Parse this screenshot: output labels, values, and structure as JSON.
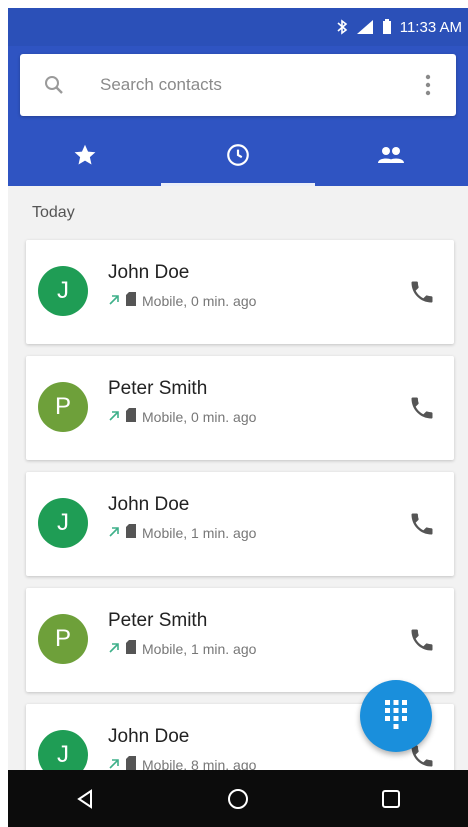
{
  "status_bar": {
    "time": "11:33 AM",
    "icons": [
      "bluetooth-icon",
      "signal-icon",
      "battery-icon"
    ]
  },
  "search": {
    "placeholder": "Search contacts",
    "icon": "search-icon",
    "menu_icon": "more-vert-icon"
  },
  "tabs": [
    {
      "icon": "star-icon",
      "active": false
    },
    {
      "icon": "clock-icon",
      "active": true
    },
    {
      "icon": "people-icon",
      "active": false
    }
  ],
  "section_title": "Today",
  "calls": [
    {
      "initial": "J",
      "name": "John Doe",
      "detail": "Mobile, 0 min. ago",
      "avatar_color": "#1f9d55"
    },
    {
      "initial": "P",
      "name": "Peter Smith",
      "detail": "Mobile, 0 min. ago",
      "avatar_color": "#6ea03a"
    },
    {
      "initial": "J",
      "name": "John Doe",
      "detail": "Mobile, 1 min. ago",
      "avatar_color": "#1f9d55"
    },
    {
      "initial": "P",
      "name": "Peter Smith",
      "detail": "Mobile, 1 min. ago",
      "avatar_color": "#6ea03a"
    },
    {
      "initial": "J",
      "name": "John Doe",
      "detail": "Mobile, 8 min. ago",
      "avatar_color": "#1f9d55"
    }
  ],
  "colors": {
    "header": "#2f54c2",
    "status_bar": "#2b50b8",
    "fab": "#1a8fdc",
    "outgoing_arrow": "#3fb08a"
  },
  "fab": {
    "icon": "dialpad-icon"
  },
  "navbar": {
    "icons": [
      "back-icon",
      "home-icon",
      "recents-icon"
    ]
  }
}
